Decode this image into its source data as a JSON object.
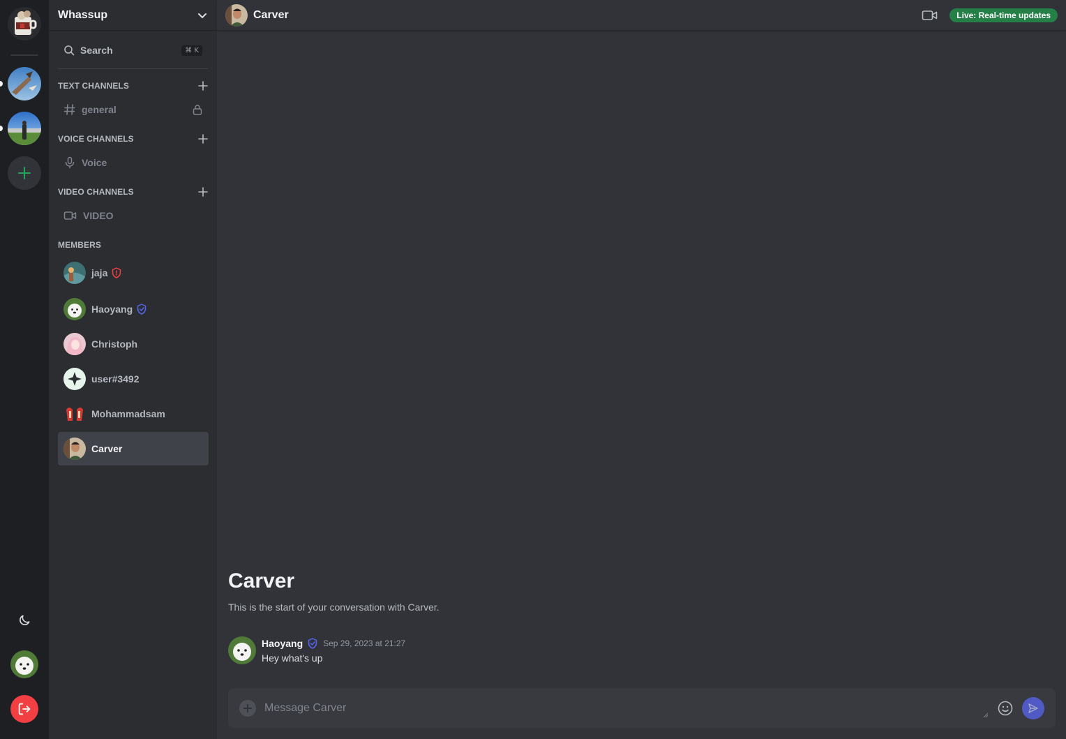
{
  "server": {
    "name": "Whassup"
  },
  "sidebar": {
    "search_label": "Search",
    "search_shortcut": "⌘ K",
    "categories": [
      {
        "label": "TEXT CHANNELS"
      },
      {
        "label": "VOICE CHANNELS"
      },
      {
        "label": "VIDEO CHANNELS"
      }
    ],
    "channels": [
      {
        "label": "general",
        "icon": "hash-icon",
        "locked": true
      },
      {
        "label": "Voice",
        "icon": "microphone-icon"
      },
      {
        "label": "VIDEO",
        "icon": "video-camera-icon"
      }
    ],
    "members_label": "MEMBERS",
    "members": [
      {
        "name": "jaja",
        "badge": "admin-shield-icon",
        "badge_color": "#f23f43"
      },
      {
        "name": "Haoyang",
        "badge": "moderator-shield-icon",
        "badge_color": "#5865f2"
      },
      {
        "name": "Christoph"
      },
      {
        "name": "user#3492"
      },
      {
        "name": "Mohammadsam"
      },
      {
        "name": "Carver",
        "active": true
      }
    ]
  },
  "conversation": {
    "name": "Carver",
    "live_badge": "Live: Real-time updates",
    "intro_title": "Carver",
    "intro_subtitle": "This is the start of your conversation with Carver.",
    "messages": [
      {
        "author": "Haoyang",
        "timestamp": "Sep 29, 2023 at 21:27",
        "text": "Hey what's up"
      }
    ],
    "composer_placeholder": "Message Carver"
  },
  "colors": {
    "accent": "#5865f2",
    "live_green": "#248046",
    "danger": "#f23f43",
    "add_green": "#23a559"
  }
}
